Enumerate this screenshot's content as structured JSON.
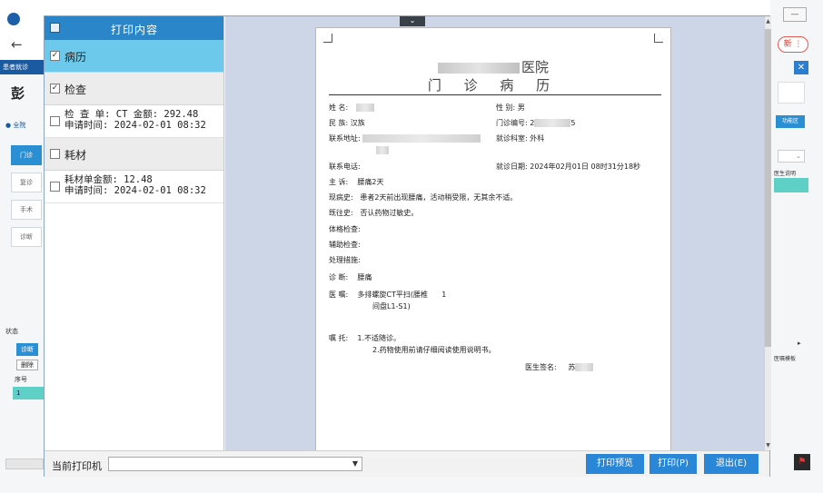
{
  "background": {
    "back_arrow": "←",
    "strip_label": "患者就诊",
    "patient_name": "彭",
    "radio_label": "● 全院",
    "side_buttons": [
      "门诊",
      "复诊",
      "手术",
      "诊断"
    ],
    "status_label": "状态",
    "chip_active": "诊断",
    "chip_delete": "删除",
    "seq_header": "序号",
    "row_number": "1",
    "window_min": "—",
    "new_button": "新 ⋮",
    "close_x": "✕",
    "func_button": "功能区",
    "doc_label": "医生说明",
    "arrow_right": "▸",
    "template_label": "医嘱模板",
    "red_icon": "⚑"
  },
  "left_panel": {
    "header_title": "打印内容",
    "groups": [
      {
        "label": "病历",
        "checked": "✓"
      },
      {
        "label": "检查",
        "checked": "✓"
      },
      {
        "label": "耗材",
        "checked": ""
      }
    ],
    "exam_item": {
      "line1": "检 查 单: CT 金额: 292.48",
      "line2": "申请时间: 2024-02-01 08:32"
    },
    "material_item": {
      "line1": "耗材单金额: 12.48",
      "line2": "申请时间: 2024-02-01 08:32"
    }
  },
  "collapse_tab": "⌄",
  "record": {
    "hospital_suffix": "医院",
    "title": "门 诊 病 历",
    "name_label": "姓    名:",
    "sex_label": "性    别:",
    "sex_value": "男",
    "ethnicity_label": "民    族:",
    "ethnicity_value": "汉族",
    "clinic_no_label": "门诊编号:",
    "clinic_no_value": "2",
    "clinic_no_tail": "5",
    "address_label": "联系地址:",
    "department_label": "就诊科室:",
    "department_value": "外科",
    "phone_label": "联系电话:",
    "visit_date_label": "就诊日期:",
    "visit_date_value": "2024年02月01日 08时31分18秒",
    "complaint_label": "主  诉:",
    "complaint_value": "腰痛2天",
    "present_label": "现病史:",
    "present_value": "患者2天前出现腰痛，活动稍受限，无其余不适。",
    "past_label": "既往史:",
    "past_value": "否认药物过敏史。",
    "exam_label": "体格检查:",
    "aux_label": "辅助检查:",
    "treat_label": "处理措施:",
    "diagnosis_label": "诊  断:",
    "diagnosis_value": "腰痛",
    "order_label": "医  嘱:",
    "order_line1": "多排螺旋CT平扫(腰椎",
    "order_qty": "1",
    "order_line2": "间盘L1-S1)",
    "advice_label": "嘱  托:",
    "advice_line1": "1.不适随诊。",
    "advice_line2": "2.药物使用前请仔细阅读使用说明书。",
    "signature_label": "医生签名:",
    "signature_value": "苏"
  },
  "bottom": {
    "printer_label": "当前打印机",
    "printer_value": "",
    "preview_button": "打印预览",
    "print_button": "打印(P)",
    "exit_button": "退出(E)"
  }
}
